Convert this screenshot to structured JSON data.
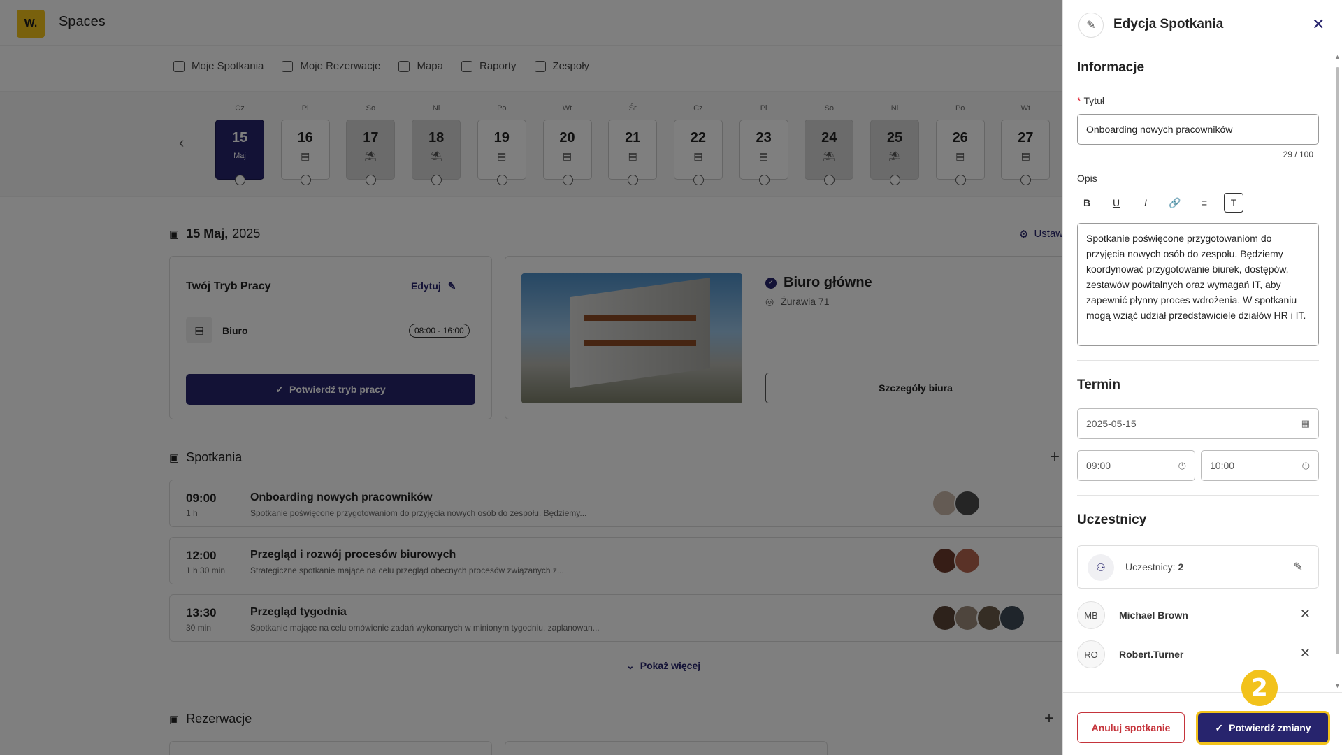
{
  "app": {
    "logo": "W.",
    "name": "Spaces"
  },
  "nav": [
    {
      "label": "Moje Spotkania",
      "icon": "list-icon"
    },
    {
      "label": "Moje Rezerwacje",
      "icon": "booking-icon"
    },
    {
      "label": "Mapa",
      "icon": "map-icon"
    },
    {
      "label": "Raporty",
      "icon": "grid-icon"
    },
    {
      "label": "Zespoły",
      "icon": "team-icon"
    }
  ],
  "days": [
    {
      "abbr": "Cz",
      "num": "15",
      "sub": "Maj",
      "type": "selected"
    },
    {
      "abbr": "Pi",
      "num": "16",
      "sub": "",
      "type": "office"
    },
    {
      "abbr": "So",
      "num": "17",
      "sub": "",
      "type": "weekend"
    },
    {
      "abbr": "Ni",
      "num": "18",
      "sub": "",
      "type": "weekend"
    },
    {
      "abbr": "Po",
      "num": "19",
      "sub": "",
      "type": "office"
    },
    {
      "abbr": "Wt",
      "num": "20",
      "sub": "",
      "type": "office"
    },
    {
      "abbr": "Śr",
      "num": "21",
      "sub": "",
      "type": "office"
    },
    {
      "abbr": "Cz",
      "num": "22",
      "sub": "",
      "type": "office"
    },
    {
      "abbr": "Pi",
      "num": "23",
      "sub": "",
      "type": "office"
    },
    {
      "abbr": "So",
      "num": "24",
      "sub": "",
      "type": "weekend"
    },
    {
      "abbr": "Ni",
      "num": "25",
      "sub": "",
      "type": "weekend"
    },
    {
      "abbr": "Po",
      "num": "26",
      "sub": "",
      "type": "office"
    },
    {
      "abbr": "Wt",
      "num": "27",
      "sub": "",
      "type": "office"
    }
  ],
  "date_header": {
    "day_month": "15 Maj,",
    "year": "2025",
    "settings": "Ustaw"
  },
  "work_mode": {
    "title": "Twój Tryb Pracy",
    "edit": "Edytuj",
    "mode": "Biuro",
    "hours": "08:00 - 16:00",
    "confirm": "Potwierdź tryb pracy"
  },
  "office": {
    "name": "Biuro główne",
    "address": "Żurawia 71",
    "details": "Szczegóły biura"
  },
  "meetings_section": {
    "title": "Spotkania",
    "show_more": "Pokaż więcej"
  },
  "meetings": [
    {
      "time": "09:00",
      "duration": "1 h",
      "title": "Onboarding nowych pracowników",
      "desc": "Spotkanie poświęcone przygotowaniom do przyjęcia nowych osób do zespołu. Będziemy..."
    },
    {
      "time": "12:00",
      "duration": "1 h 30 min",
      "title": "Przegląd i rozwój procesów biurowych",
      "desc": "Strategiczne spotkanie mające na celu przegląd obecnych procesów związanych z..."
    },
    {
      "time": "13:30",
      "duration": "30 min",
      "title": "Przegląd tygodnia",
      "desc": "Spotkanie mające na celu omówienie zadań wykonanych w minionym tygodniu, zaplanowan..."
    }
  ],
  "reservations_section": {
    "title": "Rezerwacje"
  },
  "panel": {
    "title": "Edycja Spotkania",
    "info_heading": "Informacje",
    "title_label": "Tytuł",
    "title_value": "Onboarding nowych pracowników",
    "title_counter": "29 / 100",
    "desc_label": "Opis",
    "toolbar": [
      "B",
      "U",
      "I",
      "🔗",
      "≡",
      "T"
    ],
    "desc_value": "Spotkanie poświęcone przygotowaniom do przyjęcia nowych osób do zespołu. Będziemy koordynować przygotowanie biurek, dostępów, zestawów powitalnych oraz wymagań IT, aby zapewnić płynny proces wdrożenia. W spotkaniu mogą wziąć udział przedstawiciele działów HR i IT.",
    "term_heading": "Termin",
    "date_value": "2025-05-15",
    "start_time": "09:00",
    "end_time": "10:00",
    "participants_heading": "Uczestnicy",
    "participants_label": "Uczestnicy:",
    "participants_count": "2",
    "participants": [
      {
        "initials": "MB",
        "name": "Michael Brown"
      },
      {
        "initials": "RO",
        "name": "Robert.Turner"
      }
    ],
    "cancel_button": "Anuluj spotkanie",
    "confirm_button": "Potwierdź zmiany"
  },
  "step_badge": "2",
  "colors": {
    "primary": "#27246d",
    "accent": "#f2c21b",
    "danger": "#c5343b"
  }
}
